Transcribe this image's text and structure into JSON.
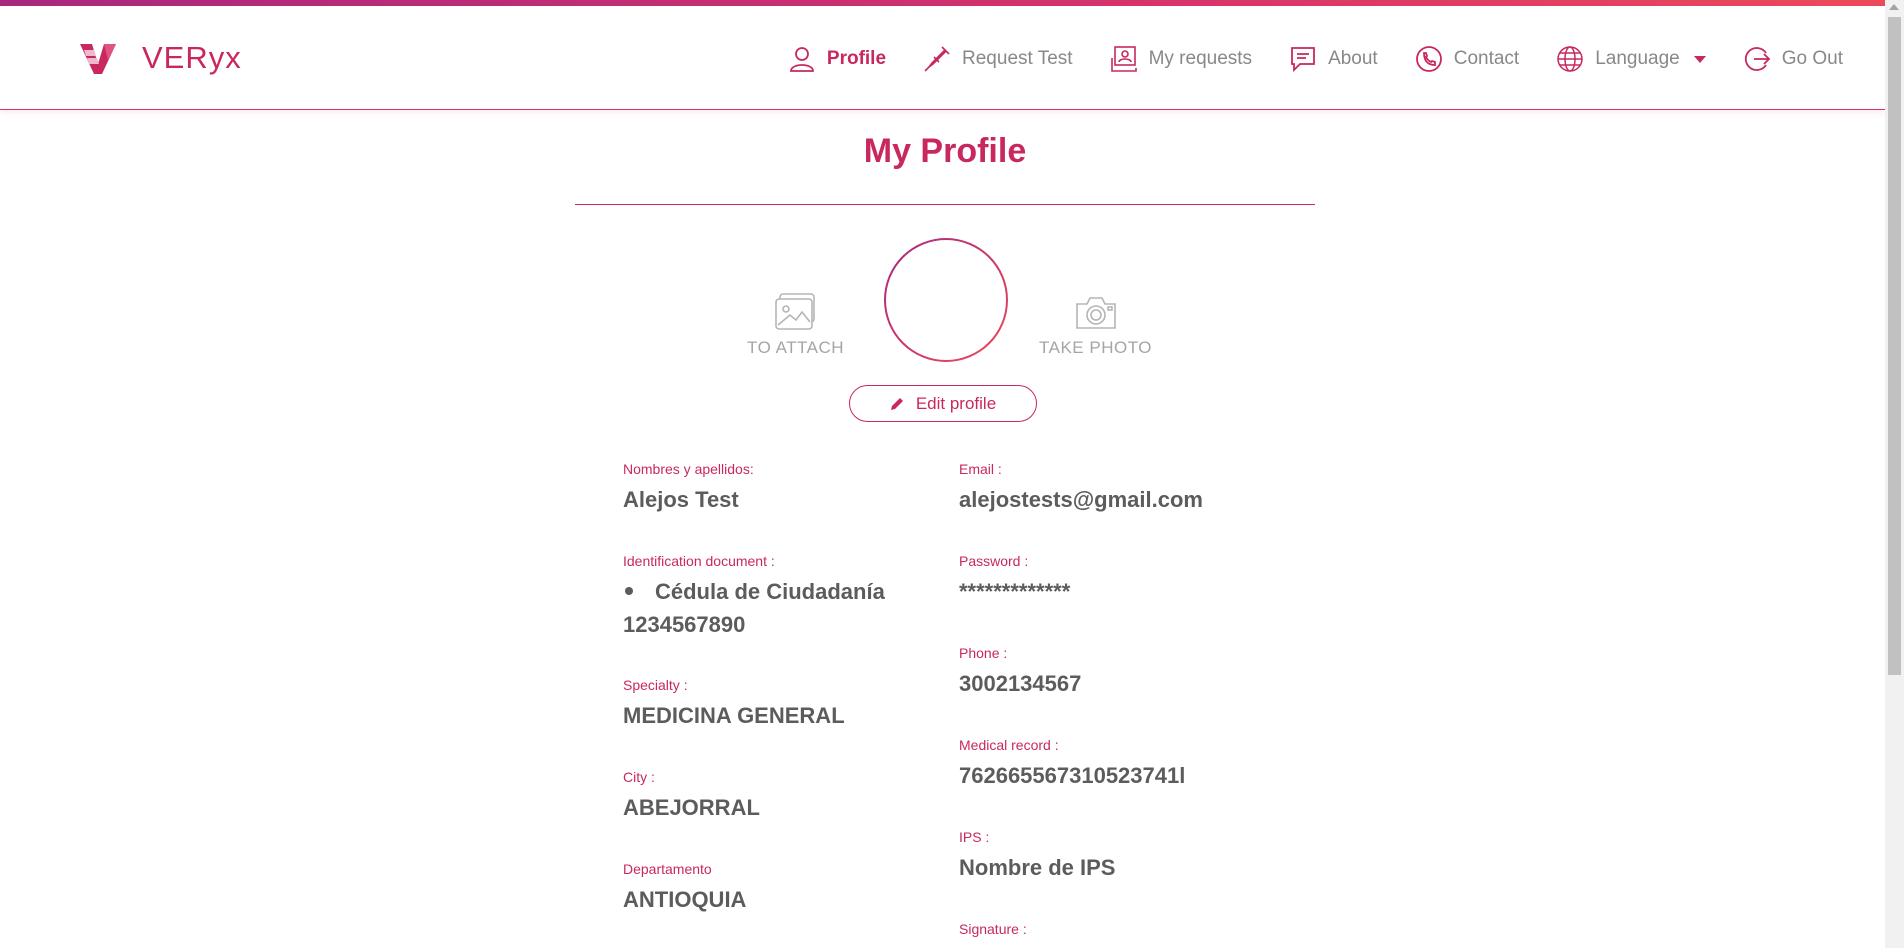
{
  "brand": {
    "name": "VERyx"
  },
  "nav": {
    "profile": "Profile",
    "request_test": "Request Test",
    "my_requests": "My requests",
    "about": "About",
    "contact": "Contact",
    "language": "Language",
    "go_out": "Go Out"
  },
  "page": {
    "title": "My Profile"
  },
  "photo": {
    "attach_label": "TO ATTACH",
    "take_photo_label": "TAKE PHOTO"
  },
  "edit_button": "Edit profile",
  "fields": {
    "names": {
      "label": "Nombres y apellidos:",
      "value": "Alejos Test"
    },
    "id_doc": {
      "label": "Identification document :",
      "type": "Cédula de Ciudadanía",
      "number": "1234567890"
    },
    "specialty": {
      "label": "Specialty :",
      "value": "MEDICINA GENERAL"
    },
    "city": {
      "label": "City :",
      "value": "ABEJORRAL"
    },
    "departamento": {
      "label": "Departamento",
      "value": "ANTIOQUIA"
    },
    "email": {
      "label": "Email :",
      "value": "alejostests@gmail.com"
    },
    "password": {
      "label": "Password :",
      "value": "*************"
    },
    "phone": {
      "label": "Phone :",
      "value": "3002134567"
    },
    "medical_record": {
      "label": "Medical record :",
      "value": "762665567310523741l"
    },
    "ips": {
      "label": "IPS :",
      "value": "Nombre de IPS"
    },
    "signature": {
      "label": "Signature :"
    }
  },
  "colors": {
    "accent": "#c8285f",
    "accent_dark": "#a8287f",
    "muted": "#888888"
  },
  "icons": [
    "veryx-logo-icon",
    "user-icon",
    "syringe-icon",
    "requests-icon",
    "chat-icon",
    "phone-icon",
    "globe-icon",
    "logout-icon",
    "image-icon",
    "camera-icon",
    "pencil-icon"
  ]
}
